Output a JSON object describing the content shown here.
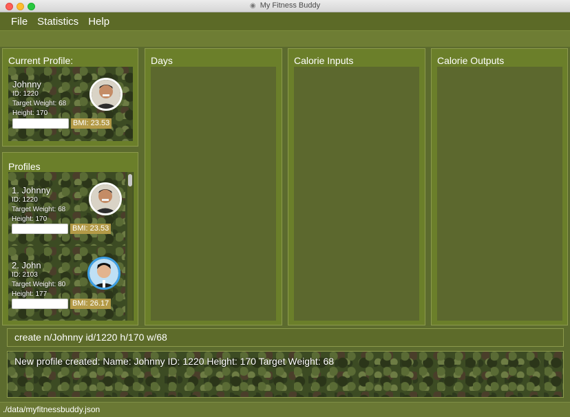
{
  "window": {
    "title": "My Fitness Buddy"
  },
  "menu": [
    "File",
    "Statistics",
    "Help"
  ],
  "current_profile": {
    "heading": "Current Profile:",
    "name": "Johnny",
    "id": "ID: 1220",
    "target_weight": "Target Weight: 68",
    "height": "Height: 170",
    "bmi": "BMI: 23.53"
  },
  "profiles": {
    "heading": "Profiles",
    "items": [
      {
        "name": "1.  Johnny",
        "id": "ID: 1220",
        "target_weight": "Target Weight: 68",
        "height": "Height: 170",
        "bmi": "BMI: 23.53"
      },
      {
        "name": "2.  John",
        "id": "ID: 2103",
        "target_weight": "Target Weight: 80",
        "height": "Height: 177",
        "bmi": "BMI: 26.17"
      }
    ]
  },
  "panels": {
    "days": "Days",
    "calorie_inputs": "Calorie Inputs",
    "calorie_outputs": "Calorie Outputs"
  },
  "command": {
    "value": "create n/Johnny id/1220 h/170 w/68"
  },
  "result": "New profile created:  Name: Johnny ID: 1220 Height: 170 Target Weight: 68",
  "status": "./data/myfitnessbuddy.json"
}
